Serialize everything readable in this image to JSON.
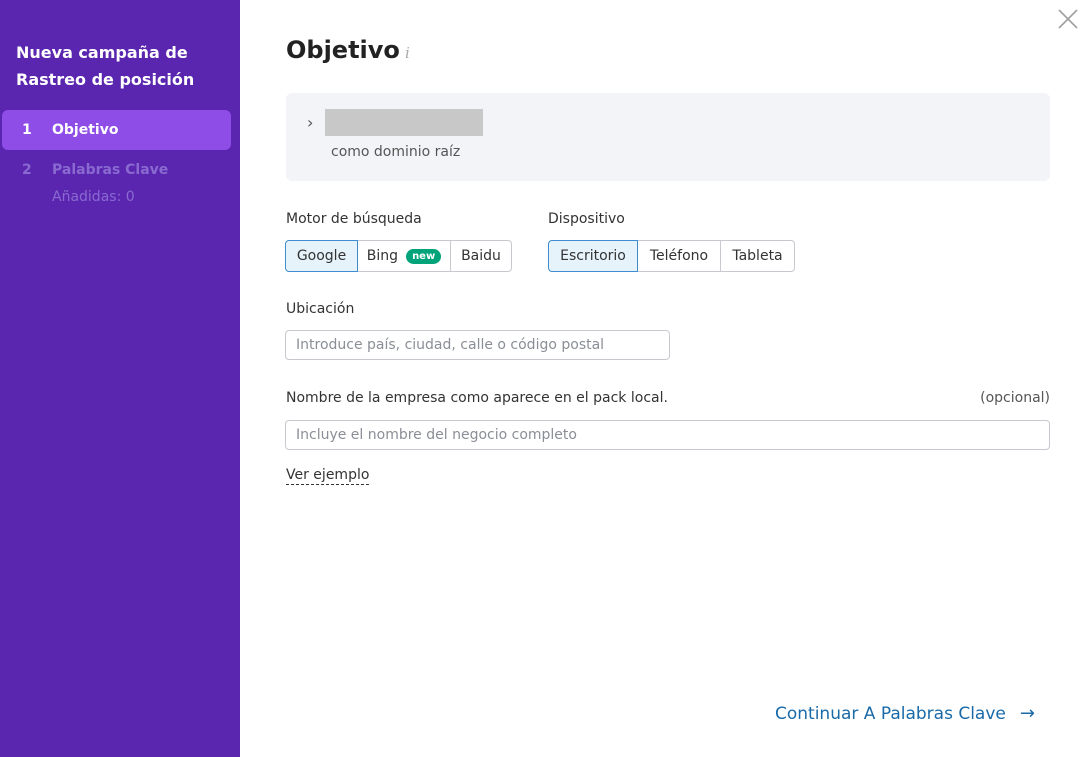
{
  "sidebar": {
    "title": "Nueva campaña de Rastreo de posición",
    "steps": [
      {
        "number": "1",
        "label": "Objetivo"
      },
      {
        "number": "2",
        "label": "Palabras Clave",
        "sub": "Añadidas: 0"
      }
    ]
  },
  "main": {
    "title": "Objetivo",
    "info_icon": "i",
    "target": {
      "domain_subtext": "como dominio raíz"
    },
    "engine": {
      "label": "Motor de búsqueda",
      "options": [
        "Google",
        "Bing",
        "Baidu"
      ],
      "selected": "Google",
      "new_badge": "new"
    },
    "device": {
      "label": "Dispositivo",
      "options": [
        "Escritorio",
        "Teléfono",
        "Tableta"
      ],
      "selected": "Escritorio"
    },
    "location": {
      "label": "Ubicación",
      "placeholder": "Introduce país, ciudad, calle o código postal",
      "value": ""
    },
    "business": {
      "label": "Nombre de la empresa como aparece en el pack local.",
      "optional": "(opcional)",
      "placeholder": "Incluye el nombre del negocio completo",
      "value": ""
    },
    "example_link": "Ver ejemplo",
    "continue_label": "Continuar A Palabras Clave",
    "continue_arrow": "→"
  },
  "colors": {
    "sidebar_bg": "#5a26b0",
    "active_step": "#8f4de8",
    "accent": "#1a6aa8",
    "badge": "#00a37a"
  }
}
